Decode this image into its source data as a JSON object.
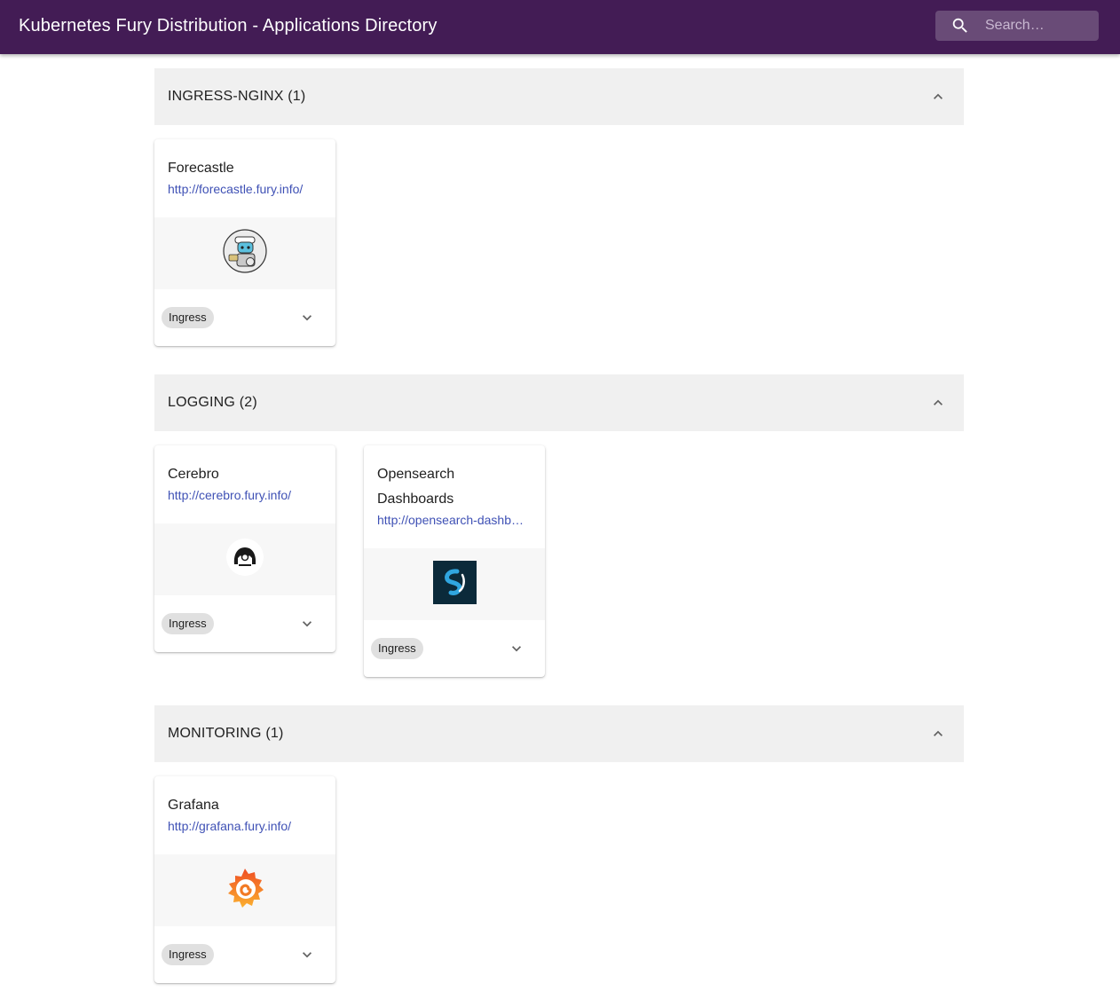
{
  "app": {
    "title": "Kubernetes Fury Distribution - Applications Directory",
    "search_placeholder": "Search…"
  },
  "sections": [
    {
      "title": "INGRESS-NGINX (1)",
      "cards": [
        {
          "name": "Forecastle",
          "url": "http://forecastle.fury.info/",
          "chip": "Ingress",
          "icon": "forecastle-logo-icon"
        }
      ]
    },
    {
      "title": "LOGGING (2)",
      "cards": [
        {
          "name": "Cerebro",
          "url": "http://cerebro.fury.info/",
          "chip": "Ingress",
          "icon": "cerebro-logo-icon"
        },
        {
          "name": "Opensearch Dashboards",
          "url": "http://opensearch-dashb…",
          "chip": "Ingress",
          "icon": "opensearch-logo-icon"
        }
      ]
    },
    {
      "title": "MONITORING (1)",
      "cards": [
        {
          "name": "Grafana",
          "url": "http://grafana.fury.info/",
          "chip": "Ingress",
          "icon": "grafana-logo-icon"
        }
      ]
    }
  ],
  "colors": {
    "appbar": "#431c55",
    "link": "#3f51b5",
    "section_header_bg": "#f0f0f0",
    "chip_bg": "#e0e0e0"
  }
}
